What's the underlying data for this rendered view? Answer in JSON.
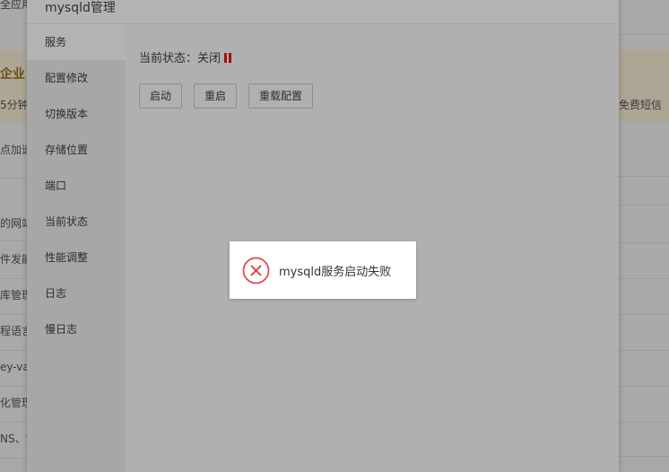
{
  "background": {
    "top_left": "全应用",
    "banner_title_left": "企业",
    "banner_sub_left": "5分钟",
    "banner_text_right": "免费短信（",
    "left_rows": [
      "点加速",
      "的网站",
      "件发能",
      "库管理",
      "程语言",
      "ey-val",
      "化管理",
      "NS、S"
    ]
  },
  "modal": {
    "title": "mysqld管理",
    "sidebar": [
      {
        "label": "服务",
        "active": true
      },
      {
        "label": "配置修改"
      },
      {
        "label": "切换版本"
      },
      {
        "label": "存储位置"
      },
      {
        "label": "端口"
      },
      {
        "label": "当前状态"
      },
      {
        "label": "性能调整"
      },
      {
        "label": "日志"
      },
      {
        "label": "慢日志"
      }
    ],
    "status_label": "当前状态：关闭",
    "buttons": {
      "start": "启动",
      "restart": "重启",
      "reload": "重载配置"
    }
  },
  "toast": {
    "message": "mysqld服务启动失败",
    "icon": "error-circle-x-icon",
    "color": "#e04b4b"
  },
  "colors": {
    "status_off": "#a31010"
  }
}
